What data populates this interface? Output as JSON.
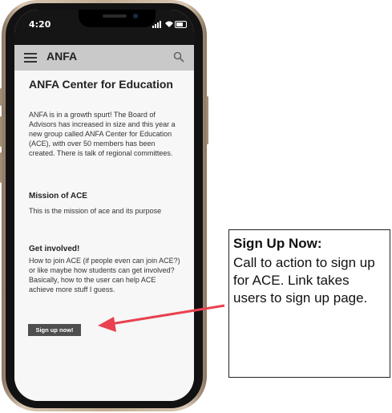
{
  "status_bar": {
    "time": "4:20"
  },
  "app_bar": {
    "title": "ANFA",
    "menu_icon": "hamburger-menu-icon",
    "search_icon": "search-icon"
  },
  "content": {
    "title": "ANFA Center for Education",
    "intro": "ANFA is in a growth spurt! The Board of Advisors has increased in size and this year a new group called ANFA Center for Education (ACE), with over 50 members has been created.  There is talk of regional committees.",
    "mission_heading": "Mission of ACE",
    "mission_text": "This is the mission of ace and its purpose",
    "involved_heading": "Get involved!",
    "involved_text": "How to join ACE (if people even can join ACE?) or like maybe how students can get involved? Basically, how to the user can help ACE achieve more stuff I guess.",
    "signup_button": "Sign up now!"
  },
  "annotation": {
    "title": "Sign Up Now:",
    "text": "Call to action to sign up for ACE. Link takes users to sign up page.",
    "arrow_color": "#e8414f"
  }
}
